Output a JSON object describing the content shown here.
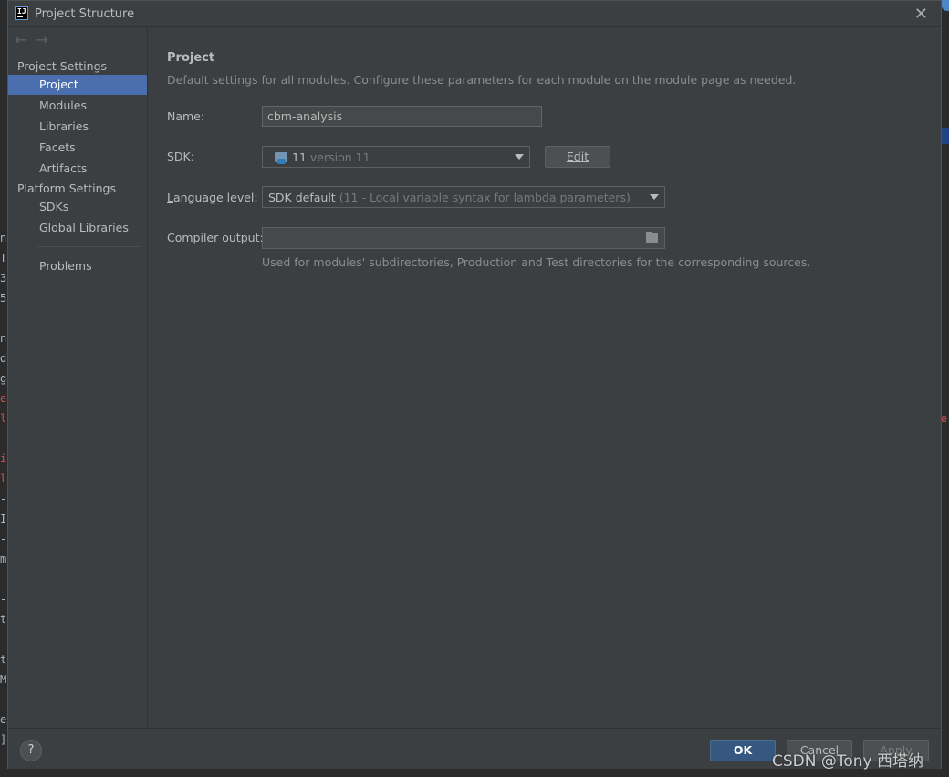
{
  "window": {
    "title": "Project Structure"
  },
  "nav": {
    "back": "←",
    "forward": "→"
  },
  "sidebar": {
    "groups": [
      {
        "label": "Project Settings",
        "items": [
          "Project",
          "Modules",
          "Libraries",
          "Facets",
          "Artifacts"
        ]
      },
      {
        "label": "Platform Settings",
        "items": [
          "SDKs",
          "Global Libraries"
        ]
      }
    ],
    "problems": "Problems",
    "selected": "Project"
  },
  "main": {
    "title": "Project",
    "description": "Default settings for all modules. Configure these parameters for each module on the module page as needed.",
    "name_label": "Name:",
    "name_value": "cbm-analysis",
    "sdk_label": "SDK:",
    "sdk_value": "11",
    "sdk_detail": "version 11",
    "edit_label": "Edit",
    "lang_label_u": "L",
    "lang_label_rest": "anguage level:",
    "lang_value": "SDK default",
    "lang_detail": "(11 - Local variable syntax for lambda parameters)",
    "compiler_label": "Compiler output:",
    "compiler_value": "",
    "compiler_hint": "Used for modules' subdirectories, Production and Test directories for the corresponding sources."
  },
  "footer": {
    "help": "?",
    "ok": "OK",
    "cancel": "Cancel",
    "apply": "Apply"
  },
  "watermark": "CSDN @Tony 西塔纳",
  "background_editor": {
    "left_chars": [
      "n",
      "T",
      "3",
      "5",
      "",
      "n",
      "d",
      "g",
      "e",
      "l",
      "",
      "i",
      "l",
      "-",
      "I",
      "-",
      "m",
      "",
      "-",
      "t",
      "",
      "t",
      "M",
      "",
      "e",
      "]"
    ],
    "right_char": "e"
  },
  "colors": {
    "dialog_bg": "#3c3f41",
    "selection": "#4b6eaf",
    "ok_button": "#365880",
    "error_text": "#d25252"
  }
}
